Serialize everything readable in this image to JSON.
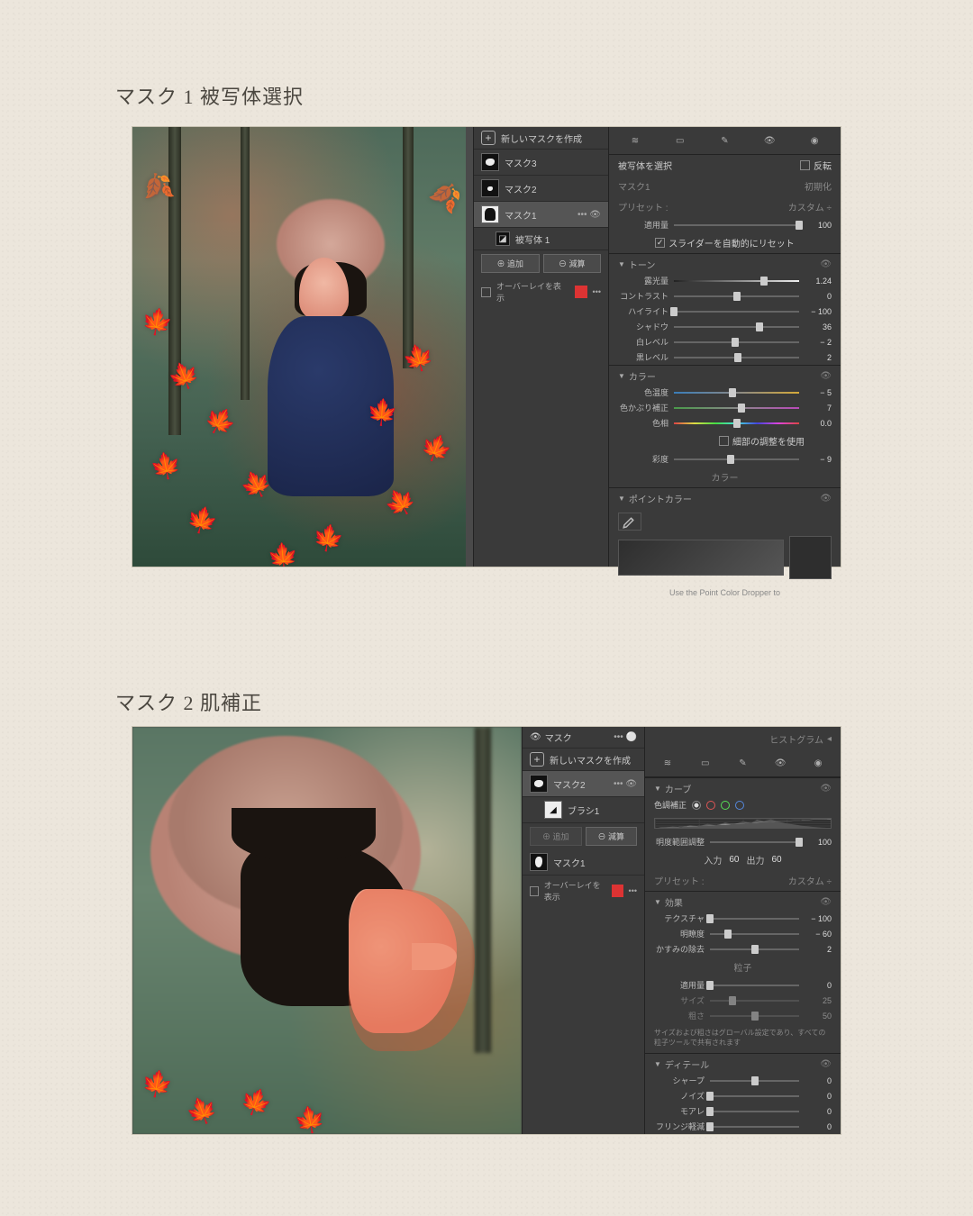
{
  "headings": {
    "h1": "マスク 1 被写体選択",
    "h2": "マスク 2 肌補正"
  },
  "shot1": {
    "mask_panel": {
      "create": "新しいマスクを作成",
      "items": [
        {
          "label": "マスク3"
        },
        {
          "label": "マスク2"
        },
        {
          "label": "マスク1",
          "selected": true
        },
        {
          "label": "被写体 1",
          "sub": true
        }
      ],
      "add": "追加",
      "sub": "減算",
      "overlay": "オーバーレイを表示"
    },
    "right": {
      "select_subject": "被写体を選択",
      "invert": "反転",
      "mask_name": "マスク1",
      "reset": "初期化",
      "preset_lbl": "プリセット :",
      "preset_val": "カスタム ÷",
      "amount_lbl": "適用量",
      "amount_val": "100",
      "auto_reset": "スライダーを自動的にリセット",
      "tone_hdr": "トーン",
      "tone": [
        {
          "lbl": "露光量",
          "val": "1.24",
          "p": 72
        },
        {
          "lbl": "コントラスト",
          "val": "0",
          "p": 50
        },
        {
          "lbl": "ハイライト",
          "val": "− 100",
          "p": 0
        },
        {
          "lbl": "シャドウ",
          "val": "36",
          "p": 68
        },
        {
          "lbl": "白レベル",
          "val": "− 2",
          "p": 49
        },
        {
          "lbl": "黒レベル",
          "val": "2",
          "p": 51
        }
      ],
      "color_hdr": "カラー",
      "color": {
        "temp": {
          "lbl": "色温度",
          "val": "− 5",
          "p": 47
        },
        "tint": {
          "lbl": "色かぶり補正",
          "val": "7",
          "p": 54
        },
        "hue": {
          "lbl": "色相",
          "val": "0.0",
          "p": 50
        },
        "fine": "細部の調整を使用",
        "sat": {
          "lbl": "彩度",
          "val": "− 9",
          "p": 45
        }
      },
      "midcolor_hdr": "カラー",
      "point_hdr": "ポイントカラー",
      "hint": "Use the Point Color Dropper to"
    }
  },
  "shot2": {
    "mask_header": "マスク",
    "histogram": "ヒストグラム",
    "mask_panel": {
      "create": "新しいマスクを作成",
      "items": [
        {
          "label": "マスク2",
          "selected": true
        },
        {
          "label": "ブラシ1",
          "sub": true
        }
      ],
      "add": "追加",
      "sub": "減算",
      "mask1": "マスク1",
      "overlay": "オーバーレイを表示"
    },
    "right": {
      "curve_hdr": "カーブ",
      "tone_corr": "色調補正",
      "range_adj": "明度範囲調整",
      "range_amount": "100",
      "in_lbl": "入力",
      "in_val": "60",
      "out_lbl": "出力",
      "out_val": "60",
      "preset_lbl": "プリセット :",
      "preset_val": "カスタム ÷",
      "effect_hdr": "効果",
      "effect": [
        {
          "lbl": "テクスチャ",
          "val": "− 100",
          "p": 0
        },
        {
          "lbl": "明瞭度",
          "val": "− 60",
          "p": 20
        },
        {
          "lbl": "かすみの除去",
          "val": "2",
          "p": 51
        }
      ],
      "grain_hdr": "粒子",
      "grain": [
        {
          "lbl": "適用量",
          "val": "0",
          "p": 0
        },
        {
          "lbl": "サイズ",
          "val": "25",
          "p": 25
        },
        {
          "lbl": "粗さ",
          "val": "50",
          "p": 50
        }
      ],
      "note": "サイズおよび粗さはグローバル設定であり、すべての粒子ツールで共有されます",
      "detail_hdr": "ディテール",
      "detail": [
        {
          "lbl": "シャープ",
          "val": "0",
          "p": 50
        },
        {
          "lbl": "ノイズ",
          "val": "0",
          "p": 0
        },
        {
          "lbl": "モアレ",
          "val": "0",
          "p": 0
        },
        {
          "lbl": "フリンジ軽減",
          "val": "0",
          "p": 0
        }
      ]
    }
  }
}
